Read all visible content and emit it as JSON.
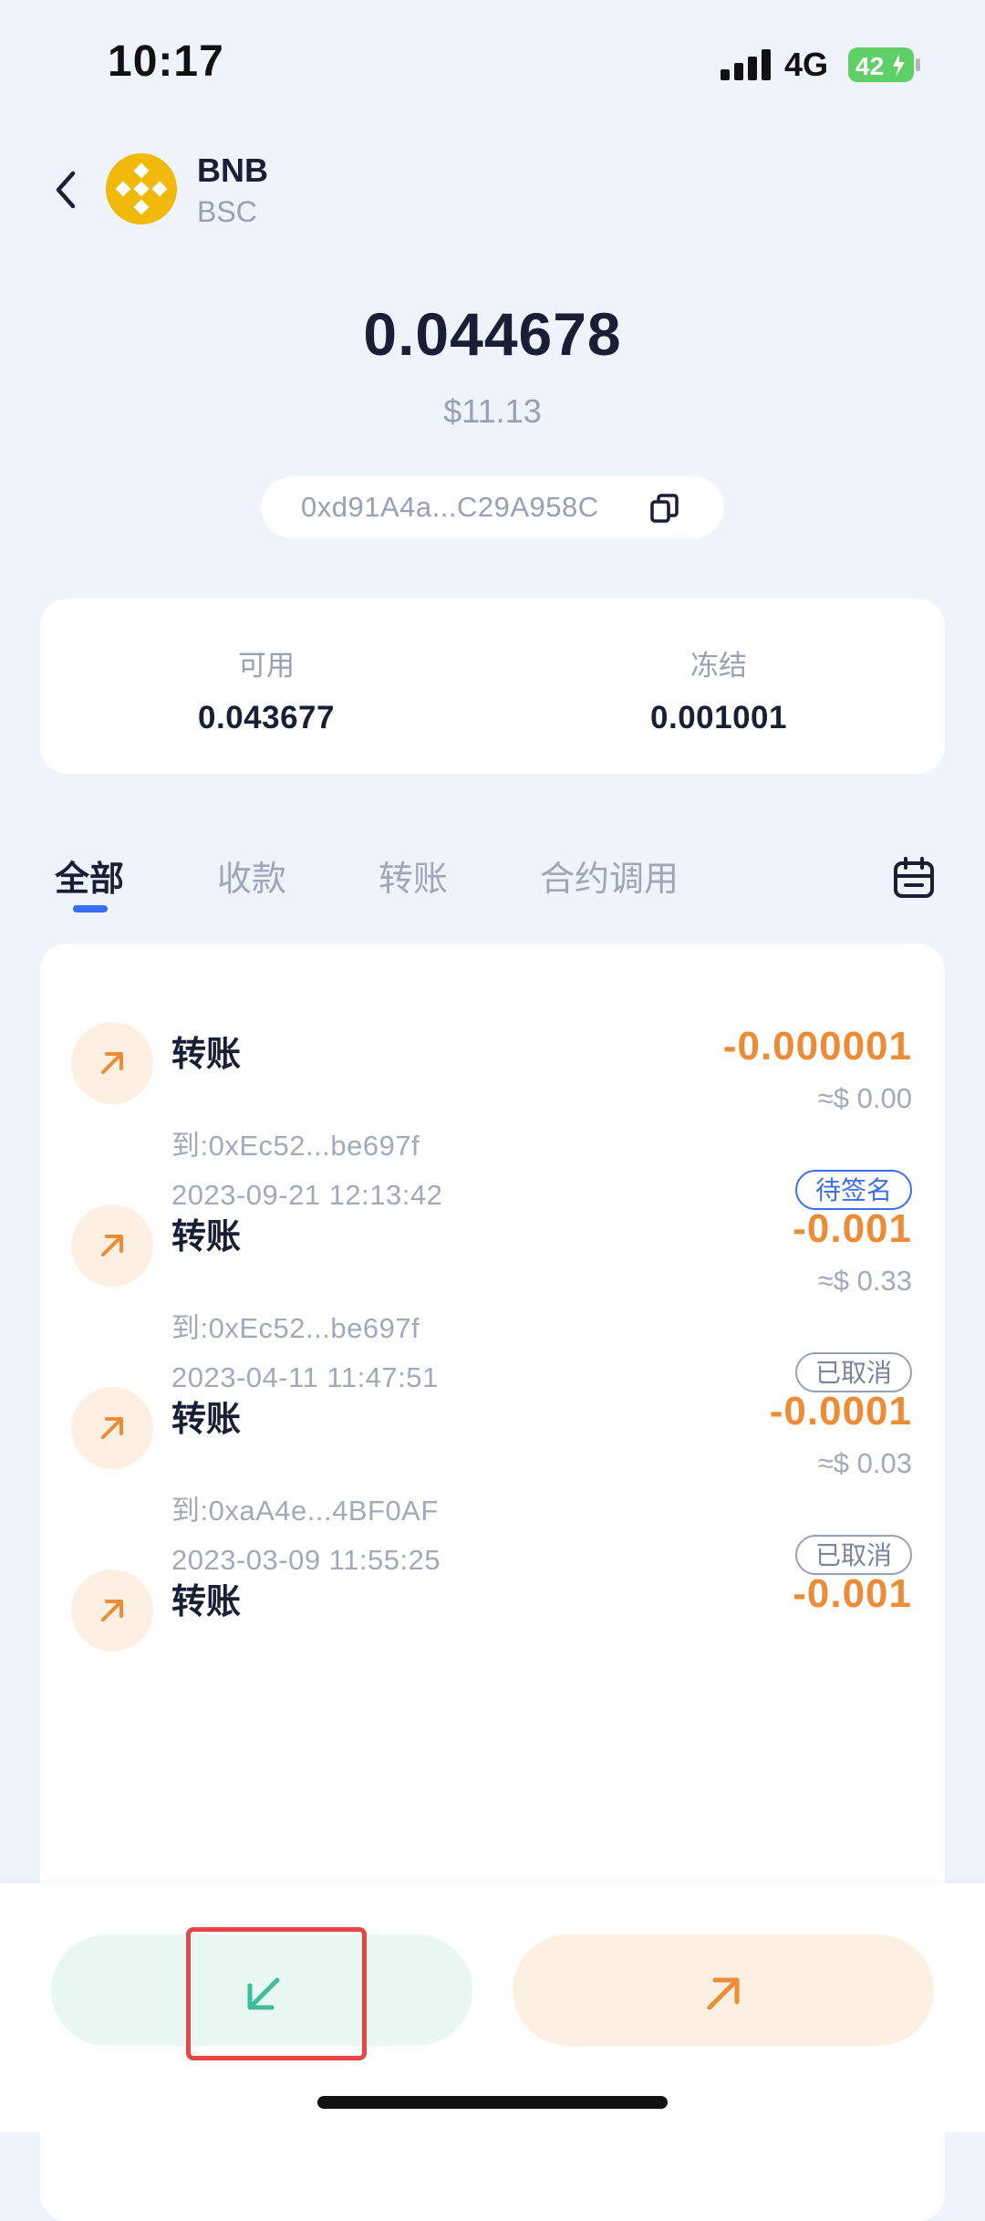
{
  "status_bar": {
    "time": "10:17",
    "network": "4G",
    "battery": "42"
  },
  "header": {
    "coin_name": "BNB",
    "chain": "BSC"
  },
  "balance": {
    "amount": "0.044678",
    "usd": "$11.13"
  },
  "address": {
    "short": "0xd91A4a...C29A958C"
  },
  "breakdown": {
    "available_label": "可用",
    "available_value": "0.043677",
    "frozen_label": "冻结",
    "frozen_value": "0.001001"
  },
  "tabs": [
    {
      "label": "全部",
      "active": true
    },
    {
      "label": "收款",
      "active": false
    },
    {
      "label": "转账",
      "active": false
    },
    {
      "label": "合约调用",
      "active": false
    }
  ],
  "transactions": [
    {
      "title": "转账",
      "to": "到:0xEc52...be697f",
      "time": "2023-09-21 12:13:42",
      "amount": "-0.000001",
      "usd": "≈$ 0.00",
      "status": "待签名"
    },
    {
      "title": "转账",
      "to": "到:0xEc52...be697f",
      "time": "2023-04-11 11:47:51",
      "amount": "-0.001",
      "usd": "≈$ 0.33",
      "status": "已取消"
    },
    {
      "title": "转账",
      "to": "到:0xaA4e...4BF0AF",
      "time": "2023-03-09 11:55:25",
      "amount": "-0.0001",
      "usd": "≈$ 0.03",
      "status": "已取消"
    },
    {
      "title": "转账",
      "amount": "-0.001"
    }
  ],
  "colors": {
    "accent": "#3a6cf4",
    "outgoing": "#ec8c36",
    "receive": "#3dbd98",
    "highlight": "#e84545"
  },
  "icons": {
    "receive": "arrow-down-left-icon",
    "send": "arrow-up-right-icon"
  }
}
